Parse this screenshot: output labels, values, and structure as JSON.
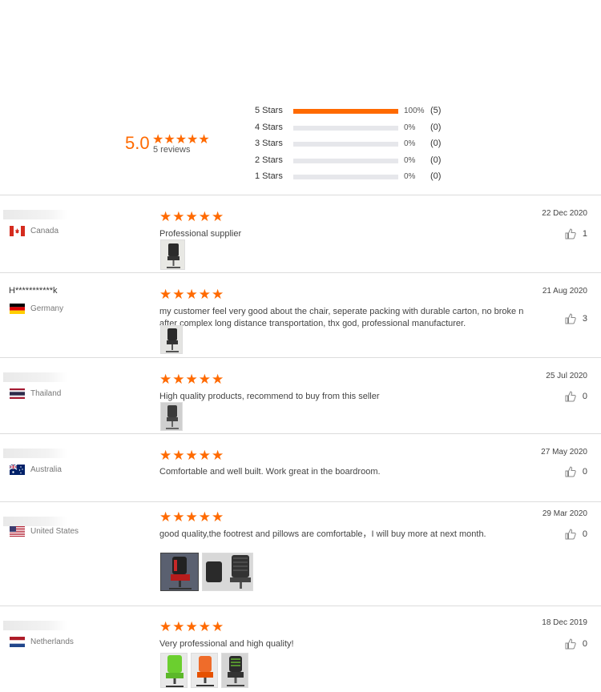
{
  "summary": {
    "average": "5.0",
    "stars": "★★★★★",
    "review_count": "5 reviews",
    "distribution": [
      {
        "label": "5  Stars",
        "pct": "100%",
        "count": "(5)",
        "fraction": 1.0
      },
      {
        "label": "4  Stars",
        "pct": "0%",
        "count": "(0)",
        "fraction": 0
      },
      {
        "label": "3  Stars",
        "pct": "0%",
        "count": "(0)",
        "fraction": 0
      },
      {
        "label": "2  Stars",
        "pct": "0%",
        "count": "(0)",
        "fraction": 0
      },
      {
        "label": "1  Stars",
        "pct": "0%",
        "count": "(0)",
        "fraction": 0
      }
    ]
  },
  "colors": {
    "accent": "#ff6a00",
    "track": "#e6e7eb"
  },
  "reviews": [
    {
      "name": "",
      "country": "Canada",
      "flag": "canada-flag-icon",
      "stars": "★★★★★",
      "date": "22 Dec 2020",
      "comment": "Professional supplier",
      "likes": "1"
    },
    {
      "name": "H***********k",
      "country": "Germany",
      "flag": "germany-flag-icon",
      "stars": "★★★★★",
      "date": "21 Aug 2020",
      "comment": "my customer feel very good about the chair, seperate packing with durable carton, no broke n after complex long distance transportation, thx god, professional manufacturer.",
      "likes": "3"
    },
    {
      "name": "",
      "country": "Thailand",
      "flag": "thailand-flag-icon",
      "stars": "★★★★★",
      "date": "25 Jul 2020",
      "comment": "High quality products, recommend to buy from this seller",
      "likes": "0"
    },
    {
      "name": "",
      "country": "Australia",
      "flag": "australia-flag-icon",
      "stars": "★★★★★",
      "date": "27 May 2020",
      "comment": "Comfortable and well built.  Work great in the boardroom.",
      "likes": "0"
    },
    {
      "name": "",
      "country": "United States",
      "flag": "usa-flag-icon",
      "stars": "★★★★★",
      "date": "29 Mar 2020",
      "comment": "good quality,the footrest and pillows are comfortable，I will buy more at next month.",
      "likes": "0"
    },
    {
      "name": "",
      "country": "Netherlands",
      "flag": "netherlands-flag-icon",
      "stars": "★★★★★",
      "date": "18 Dec 2019",
      "comment": "Very professional and high quality!",
      "likes": "0"
    }
  ]
}
